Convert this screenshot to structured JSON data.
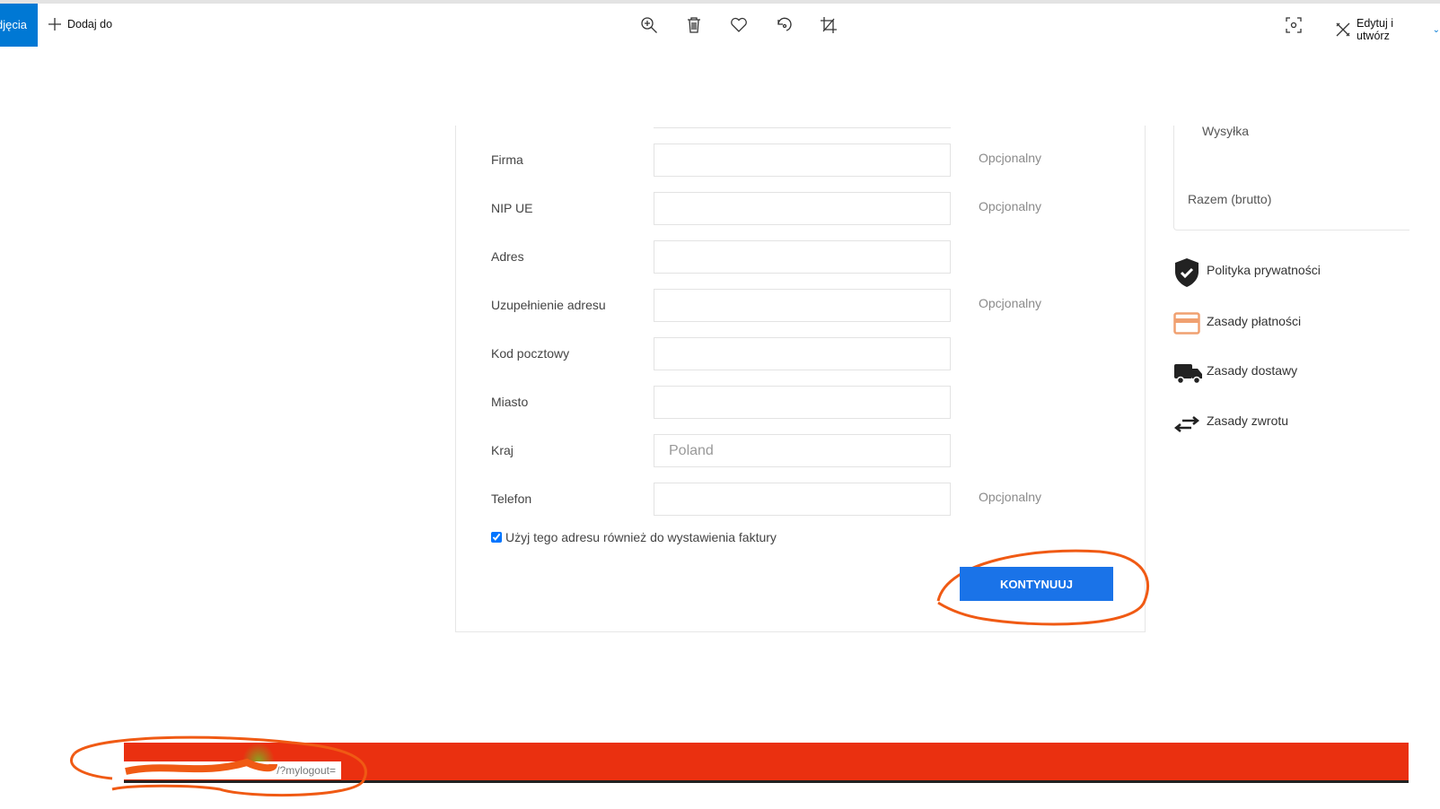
{
  "toolbar": {
    "active_tab": "djęcia",
    "add_to": "Dodaj do",
    "edit_create": "Edytuj i utwórz",
    "icons": [
      "zoom-in-icon",
      "trash-icon",
      "heart-icon",
      "rotate-icon",
      "crop-icon",
      "screen-capture-icon",
      "edit-create-icon"
    ]
  },
  "form": {
    "rows": [
      {
        "label": "Firma",
        "value": "",
        "optional": "Opcjonalny"
      },
      {
        "label": "NIP UE",
        "value": "",
        "optional": "Opcjonalny"
      },
      {
        "label": "Adres",
        "value": "",
        "optional": ""
      },
      {
        "label": "Uzupełnienie adresu",
        "value": "",
        "optional": "Opcjonalny"
      },
      {
        "label": "Kod pocztowy",
        "value": "",
        "optional": ""
      },
      {
        "label": "Miasto",
        "value": "",
        "optional": ""
      },
      {
        "label": "Kraj",
        "value": "Poland",
        "optional": ""
      },
      {
        "label": "Telefon",
        "value": "",
        "optional": "Opcjonalny"
      }
    ],
    "checkbox_label": "Użyj tego adresu również do wystawienia faktury",
    "checkbox_checked": true,
    "continue_button": "KONTYNUUJ"
  },
  "summary": {
    "shipping": "Wysyłka",
    "total": "Razem (brutto)"
  },
  "policies": [
    {
      "label": "Polityka prywatności",
      "icon": "shield-check-icon"
    },
    {
      "label": "Zasady płatności",
      "icon": "credit-card-icon"
    },
    {
      "label": "Zasady dostawy",
      "icon": "truck-icon"
    },
    {
      "label": "Zasady zwrotu",
      "icon": "swap-arrows-icon"
    }
  ],
  "footer": {
    "url_fragment": "/?mylogout="
  },
  "colors": {
    "accent": "#0078d4",
    "button": "#1a73e8",
    "footer_bar": "#ea3010",
    "annotation": "#f05a14",
    "card_icon": "#f0a070"
  }
}
